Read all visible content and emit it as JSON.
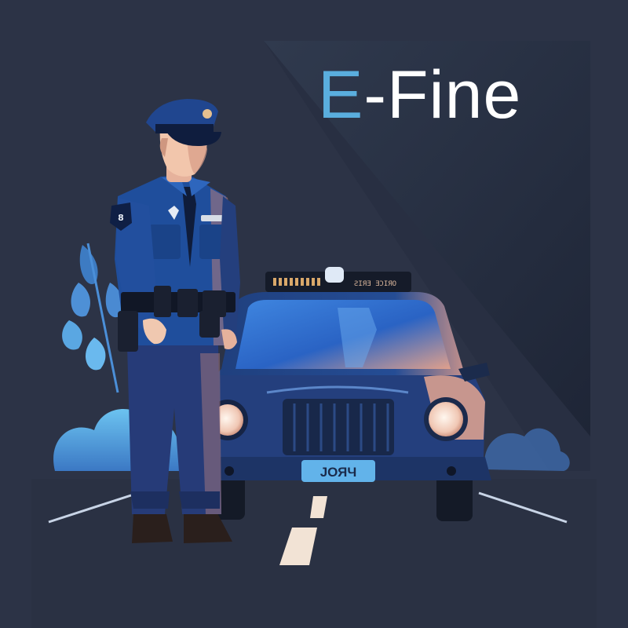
{
  "title": {
    "accent": "E",
    "rest": "-Fine"
  },
  "plate": {
    "text": "ЈОЯЧ"
  },
  "lightbar": {
    "text": "ƧIЯƎ ƎƆIЯO"
  },
  "shoulder_patch": {
    "text": "8"
  },
  "colors": {
    "background": "#2d3447",
    "accent": "#5aaede",
    "title_text": "#ffffff",
    "uniform": "#1f4e9c",
    "car_body": "#234a8c",
    "headlight": "#f4ddd0"
  }
}
